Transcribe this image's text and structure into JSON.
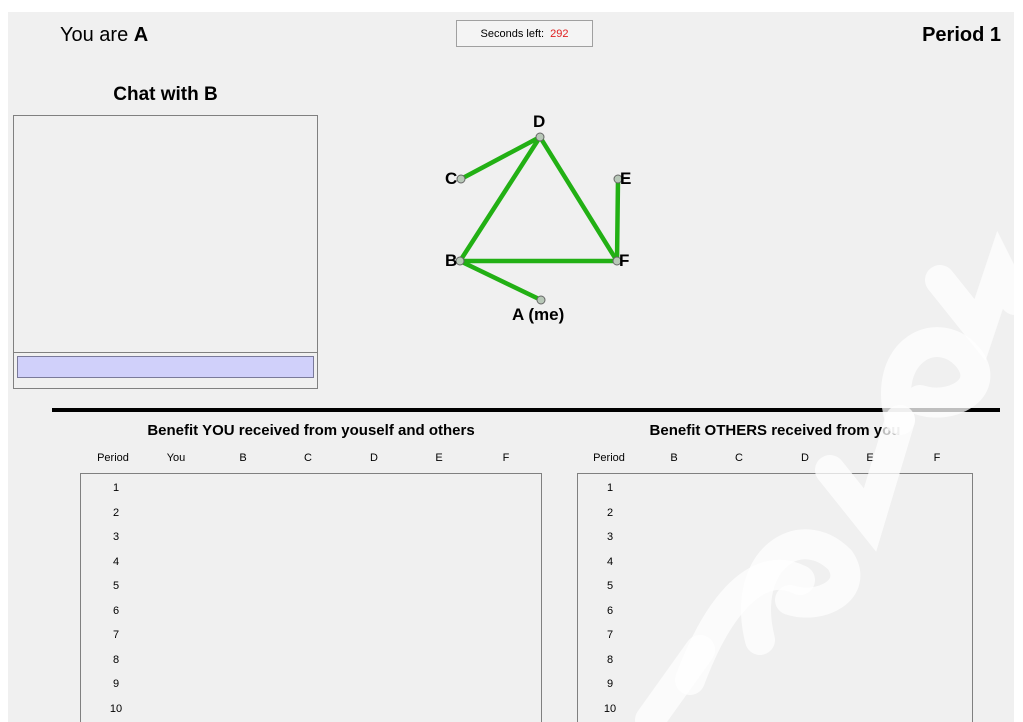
{
  "header": {
    "you_are_prefix": "You are",
    "you_are_letter": "A",
    "timer_label": "Seconds left:",
    "timer_value": "292",
    "period_title": "Period 1"
  },
  "chat": {
    "title": "Chat with B",
    "input_value": ""
  },
  "network": {
    "edge_color": "#22b014",
    "node_labels": {
      "A": "A (me)",
      "B": "B",
      "C": "C",
      "D": "D",
      "E": "E",
      "F": "F"
    },
    "edges": [
      [
        "B",
        "A"
      ],
      [
        "B",
        "D"
      ],
      [
        "B",
        "F"
      ],
      [
        "C",
        "D"
      ],
      [
        "D",
        "F"
      ],
      [
        "E",
        "F"
      ]
    ]
  },
  "table_you": {
    "title": "Benefit YOU received from youself and others",
    "columns": [
      "Period",
      "You",
      "B",
      "C",
      "D",
      "E",
      "F"
    ],
    "rows": [
      "1",
      "2",
      "3",
      "4",
      "5",
      "6",
      "7",
      "8",
      "9",
      "10"
    ]
  },
  "table_others": {
    "title": "Benefit OTHERS received from you",
    "columns": [
      "Period",
      "B",
      "C",
      "D",
      "E",
      "F"
    ],
    "rows": [
      "1",
      "2",
      "3",
      "4",
      "5",
      "6",
      "7",
      "8",
      "9",
      "10"
    ]
  },
  "colors": {
    "timer_value": "#e02020",
    "chat_input_bg": "#d0d0fa",
    "background": "#f0f0f0"
  }
}
